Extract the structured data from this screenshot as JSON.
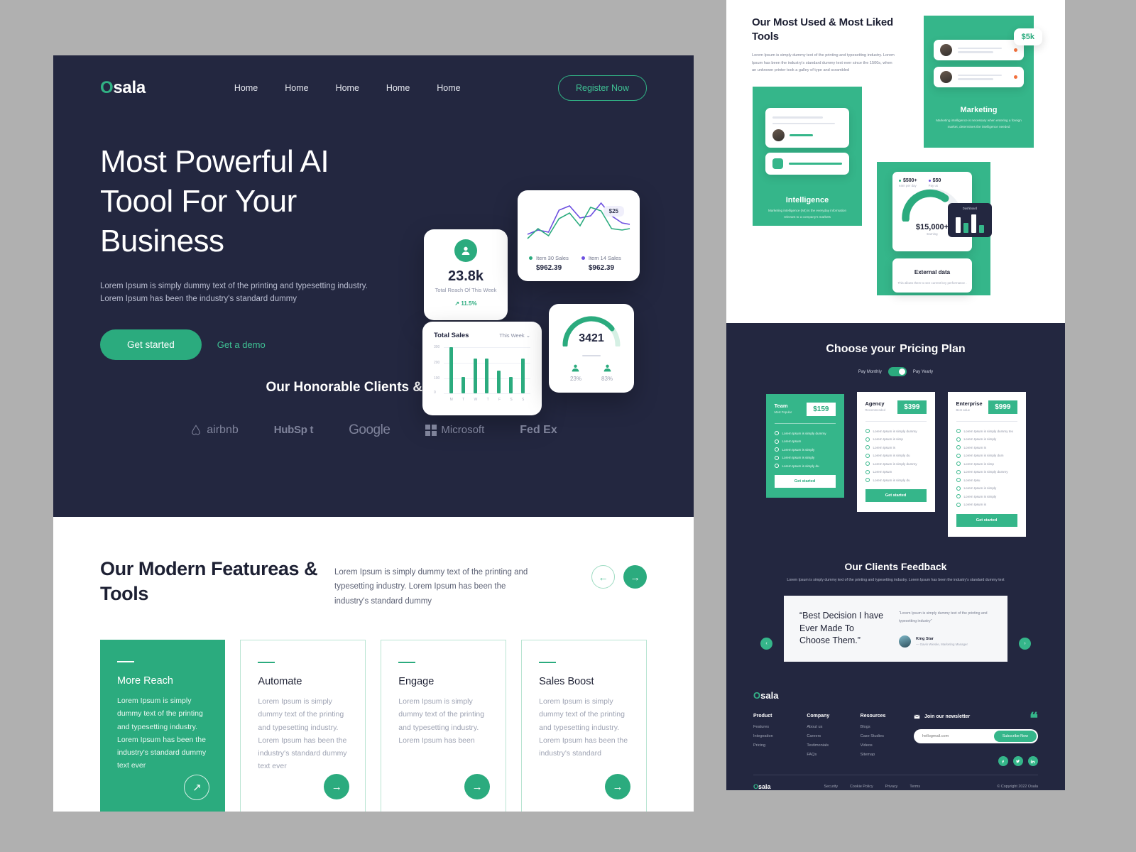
{
  "brand": {
    "name_prefix": "O",
    "name_rest": "sala",
    "accent": "#2bab7e",
    "dark": "#232740"
  },
  "header": {
    "nav": [
      {
        "label": "Home"
      },
      {
        "label": "Home"
      },
      {
        "label": "Home"
      },
      {
        "label": "Home"
      },
      {
        "label": "Home"
      }
    ],
    "register_label": "Register Now"
  },
  "hero": {
    "title": "Most Powerful AI Toool For Your Business",
    "subtitle": "Lorem Ipsum is simply dummy text of the printing and typesetting industry. Lorem Ipsum has been the industry's standard dummy",
    "primary_cta": "Get started",
    "secondary_cta": "Get a demo",
    "reach_card": {
      "icon": "user-icon",
      "value": "23.8k",
      "label": "Total Reach Of This Week",
      "trend": "↗ 11.5%"
    },
    "line_card": {
      "tooltip": "$25",
      "legend": [
        {
          "name": "Item 30 Sales",
          "value": "$962.39",
          "color": "#2bab7e"
        },
        {
          "name": "Item 14 Sales",
          "value": "$962.39",
          "color": "#6c4fe0"
        }
      ]
    },
    "bars_card": {
      "title": "Total Sales",
      "range": "This Week",
      "y_ticks": [
        "300",
        "200",
        "100",
        "0"
      ],
      "x_labels": [
        "M",
        "T",
        "W",
        "T",
        "F",
        "S",
        "S"
      ],
      "values": [
        295,
        103,
        222,
        222,
        145,
        103,
        222
      ]
    },
    "gauge_card": {
      "value": "3421",
      "left_pct": "23%",
      "right_pct": "83%"
    }
  },
  "clients": {
    "heading": "Our Honorable Clients & Partners",
    "logos": [
      "airbnb",
      "HubSp t",
      "Google",
      "Microsoft",
      "Fed Ex"
    ]
  },
  "features": {
    "title": "Our Modern Featureas & Tools",
    "description": "Lorem Ipsum is simply dummy text of the printing and typesetting industry. Lorem Ipsum has been the industry's standard dummy",
    "prev_icon": "arrow-left-icon",
    "next_icon": "arrow-right-icon",
    "cards": [
      {
        "title": "More Reach",
        "text": "Lorem Ipsum is simply dummy text of the printing and typesetting industry. Lorem Ipsum has been the industry's standard dummy text ever",
        "highlighted": true,
        "icon": "arrow-up-right-icon"
      },
      {
        "title": "Automate",
        "text": "Lorem Ipsum is simply dummy text of the printing and typesetting industry. Lorem Ipsum has been the industry's standard dummy text ever",
        "highlighted": false,
        "icon": "arrow-right-icon"
      },
      {
        "title": "Engage",
        "text": "Lorem Ipsum is simply dummy text of the printing and typesetting industry. Lorem Ipsum has been",
        "highlighted": false,
        "icon": "arrow-right-icon"
      },
      {
        "title": "Sales Boost",
        "text": "Lorem Ipsum is simply dummy text of the printing and typesetting industry. Lorem Ipsum has been the industry's standard",
        "highlighted": false,
        "icon": "arrow-right-icon"
      }
    ]
  },
  "tools": {
    "title": "Our Most Used & Most Liked Tools",
    "description": "Lorem Ipsum is simply dummy text of the printing and typesetting industry. Lorem Ipsum has been the industry's standard dummy text ever since the 1500s, when an unknown printer took a galley of type and scrambled",
    "marketing": {
      "badge": "$5k",
      "title": "Marketing",
      "text": "Marketing intelligence is necessary when entering a foreign market, determines the intelligence needed"
    },
    "intelligence": {
      "title": "Intelligence",
      "text": "Marketing intelligence (MI) is the everyday information relevant to a company's markets"
    },
    "external": {
      "earn_value": "$500+",
      "earn_label": "earn per day",
      "pay_value": "$50",
      "pay_label": "Pay us",
      "total": "$15,000+",
      "total_label": "Earning",
      "mini_title": "Dashboard",
      "card_title": "External data",
      "card_text": "This allows them to see current key performance ."
    }
  },
  "pricing": {
    "title_part1": "Choose your",
    "title_part2": "Pricing Plan",
    "monthly_label": "Pay Monthly",
    "yearly_label": "Pay Yearly",
    "plans": [
      {
        "name": "Team",
        "tag": "Most Popular",
        "price": "$159",
        "cta": "Get started",
        "features": [
          "Lorem Ipsum is simply dummy",
          "Lorem Ipsum",
          "Lorem Ipsum is simply",
          "Lorem Ipsum is simply",
          "Lorem Ipsum is simply du"
        ]
      },
      {
        "name": "Agency",
        "tag": "Recommended",
        "price": "$399",
        "cta": "Get started",
        "features": [
          "Lorem Ipsum is simply dummy",
          "Lorem Ipsum is simp",
          "Lorem Ipsum is",
          "Lorem Ipsum is simply du",
          "Lorem Ipsum is simply dummy",
          "Lorem Ipsum",
          "Lorem Ipsum is simply du"
        ]
      },
      {
        "name": "Enterprise",
        "tag": "Best value",
        "price": "$999",
        "cta": "Get started",
        "features": [
          "Lorem Ipsum is simply dummy tex",
          "Lorem Ipsum is simply",
          "Lorem Ipsum is",
          "Lorem Ipsum is simply dum",
          "Lorem Ipsum is simp",
          "Lorem Ipsum is simply dummy",
          "Lorem Ipsu",
          "Lorem Ipsum is simply",
          "Lorem Ipsum is simply",
          "Lorem Ipsum is"
        ]
      }
    ]
  },
  "feedback": {
    "title": "Our Clients Feedback",
    "subtitle": "Lorem Ipsum is simply dummy text of the printing and typesetting industry. Lorem Ipsum has been the industry's standard dummy text",
    "quote": "“Best Decision I have Ever Made To Choose Them.”",
    "body": "“Lorem Ipsum is simply dummy text of the printing and typesetting industry”",
    "author": "King Star",
    "author_role": "— Gavin Wieske, Marketing Manager",
    "prev_icon": "chevron-left-icon",
    "next_icon": "chevron-right-icon"
  },
  "footer": {
    "columns": [
      {
        "heading": "Product",
        "links": [
          "Features",
          "Integeation",
          "Pricing"
        ]
      },
      {
        "heading": "Company",
        "links": [
          "About us",
          "Careers",
          "Testimonials",
          "FAQs"
        ]
      },
      {
        "heading": "Resources",
        "links": [
          "Blogs",
          "Case Studies",
          "Videos",
          "Sitemap"
        ]
      }
    ],
    "newsletter_heading": "Join our newsletter",
    "newsletter_placeholder": "hellogmail.com",
    "subscribe_label": "Subscribe Now",
    "socials": [
      "facebook-icon",
      "twitter-icon",
      "linkedin-icon"
    ],
    "legal": [
      "Security",
      "Cookie Policy",
      "Privacy",
      "Terms"
    ],
    "copyright": "© Copyright 2022 Osala"
  },
  "chart_data": [
    {
      "type": "line",
      "title": "Item Sales",
      "x": [
        0,
        1,
        2,
        3,
        4,
        5,
        6,
        7,
        8,
        9,
        10
      ],
      "series": [
        {
          "name": "Item 30 Sales",
          "color": "#2bab7e",
          "values": [
            22,
            36,
            28,
            52,
            60,
            42,
            70,
            66,
            34,
            32,
            34
          ]
        },
        {
          "name": "Item 14 Sales",
          "color": "#6c4fe0",
          "values": [
            28,
            34,
            32,
            66,
            72,
            58,
            60,
            78,
            56,
            44,
            40
          ]
        }
      ],
      "annotations": [
        {
          "label": "$25",
          "x": 7
        }
      ],
      "legend": "bottom",
      "grid": false
    },
    {
      "type": "bar",
      "title": "Total Sales",
      "categories": [
        "M",
        "T",
        "W",
        "T",
        "F",
        "S",
        "S"
      ],
      "values": [
        295,
        103,
        222,
        222,
        145,
        103,
        222
      ],
      "ylim": [
        0,
        300
      ],
      "yticks": [
        0,
        100,
        200,
        300
      ],
      "grid": true,
      "color": "#2bab7e"
    },
    {
      "type": "gauge",
      "title": "3421",
      "value": 3421,
      "segments": [
        {
          "label": "23%",
          "value": 23
        },
        {
          "label": "83%",
          "value": 83
        }
      ],
      "color": "#2bab7e"
    },
    {
      "type": "gauge",
      "title": "$15,000+",
      "subtitle": "Earning",
      "legend": [
        {
          "name": "earn per day",
          "value": "$500+",
          "color": "#2bab7e"
        },
        {
          "name": "Pay us",
          "value": "$50",
          "color": "#6c4fe0"
        }
      ],
      "percent": 62,
      "color": "#2bab7e"
    }
  ]
}
